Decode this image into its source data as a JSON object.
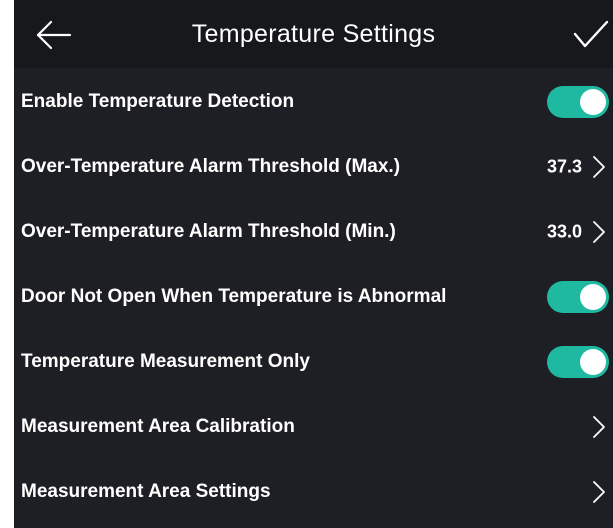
{
  "header": {
    "title": "Temperature Settings",
    "back_icon": "arrow-left-icon",
    "confirm_icon": "checkmark-icon"
  },
  "colors": {
    "toggle_on": "#1fb8a1",
    "background": "#1e1f24",
    "header_background": "#17181c"
  },
  "settings": [
    {
      "label": "Enable Temperature Detection",
      "control": "toggle",
      "on": true
    },
    {
      "label": "Over-Temperature Alarm Threshold (Max.)",
      "control": "value",
      "value": "37.3"
    },
    {
      "label": "Over-Temperature Alarm Threshold (Min.)",
      "control": "value",
      "value": "33.0"
    },
    {
      "label": "Door Not Open When Temperature is Abnormal",
      "control": "toggle",
      "on": true
    },
    {
      "label": "Temperature Measurement Only",
      "control": "toggle",
      "on": true
    },
    {
      "label": "Measurement Area Calibration",
      "control": "link"
    },
    {
      "label": "Measurement Area Settings",
      "control": "link"
    }
  ]
}
